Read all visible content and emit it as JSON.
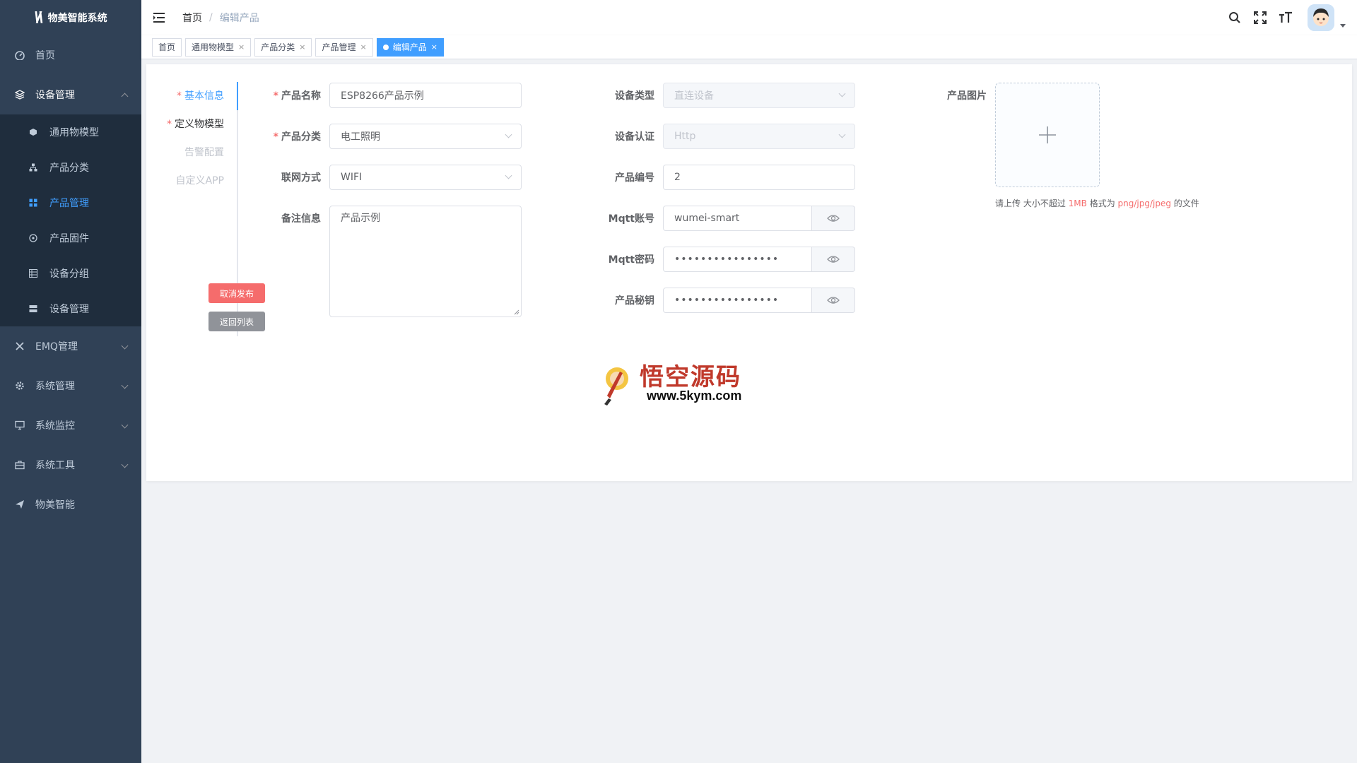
{
  "app": {
    "title": "物美智能系统"
  },
  "sidebar": {
    "items": [
      {
        "label": "首页",
        "icon": "dashboard-icon"
      },
      {
        "label": "设备管理",
        "icon": "layers-icon",
        "open": true,
        "children": [
          {
            "label": "通用物模型",
            "icon": "cube-icon"
          },
          {
            "label": "产品分类",
            "icon": "tree-icon"
          },
          {
            "label": "产品管理",
            "icon": "grid-icon",
            "active": true
          },
          {
            "label": "产品固件",
            "icon": "firmware-icon"
          },
          {
            "label": "设备分组",
            "icon": "group-icon"
          },
          {
            "label": "设备管理",
            "icon": "server-icon"
          }
        ]
      },
      {
        "label": "EMQ管理",
        "icon": "tools-icon"
      },
      {
        "label": "系统管理",
        "icon": "gear-icon"
      },
      {
        "label": "系统监控",
        "icon": "monitor-icon"
      },
      {
        "label": "系统工具",
        "icon": "toolbox-icon"
      },
      {
        "label": "物美智能",
        "icon": "send-icon"
      }
    ]
  },
  "breadcrumb": {
    "home": "首页",
    "current": "编辑产品"
  },
  "tags": [
    "首页",
    "通用物模型",
    "产品分类",
    "产品管理",
    "编辑产品"
  ],
  "steps": {
    "items": [
      "基本信息",
      "定义物模型",
      "告警配置",
      "自定义APP"
    ],
    "cancel_publish": "取消发布",
    "back_to_list": "返回列表"
  },
  "form": {
    "product_name": {
      "label": "产品名称",
      "value": "ESP8266产品示例"
    },
    "category": {
      "label": "产品分类",
      "value": "电工照明"
    },
    "network": {
      "label": "联网方式",
      "value": "WIFI"
    },
    "remark": {
      "label": "备注信息",
      "value": "产品示例"
    },
    "device_type": {
      "label": "设备类型",
      "value": "直连设备"
    },
    "auth": {
      "label": "设备认证",
      "value": "Http"
    },
    "product_no": {
      "label": "产品编号",
      "value": "2"
    },
    "mqtt_account": {
      "label": "Mqtt账号",
      "value": "wumei-smart"
    },
    "mqtt_password": {
      "label": "Mqtt密码",
      "value": "••••••••••••••••"
    },
    "product_secret": {
      "label": "产品秘钥",
      "value": "••••••••••••••••"
    },
    "image": {
      "label": "产品图片"
    }
  },
  "upload_tip": {
    "prefix": "请上传 大小不超过 ",
    "size": "1MB",
    "mid": " 格式为 ",
    "formats": "png/jpg/jpeg",
    "suffix": " 的文件"
  },
  "watermark": {
    "title": "悟空源码",
    "url": "www.5kym.com"
  },
  "colors": {
    "sidebar": "#304156",
    "submenu": "#1f2d3d",
    "accent": "#409eff",
    "danger": "#f56c6c",
    "info": "#909399"
  }
}
